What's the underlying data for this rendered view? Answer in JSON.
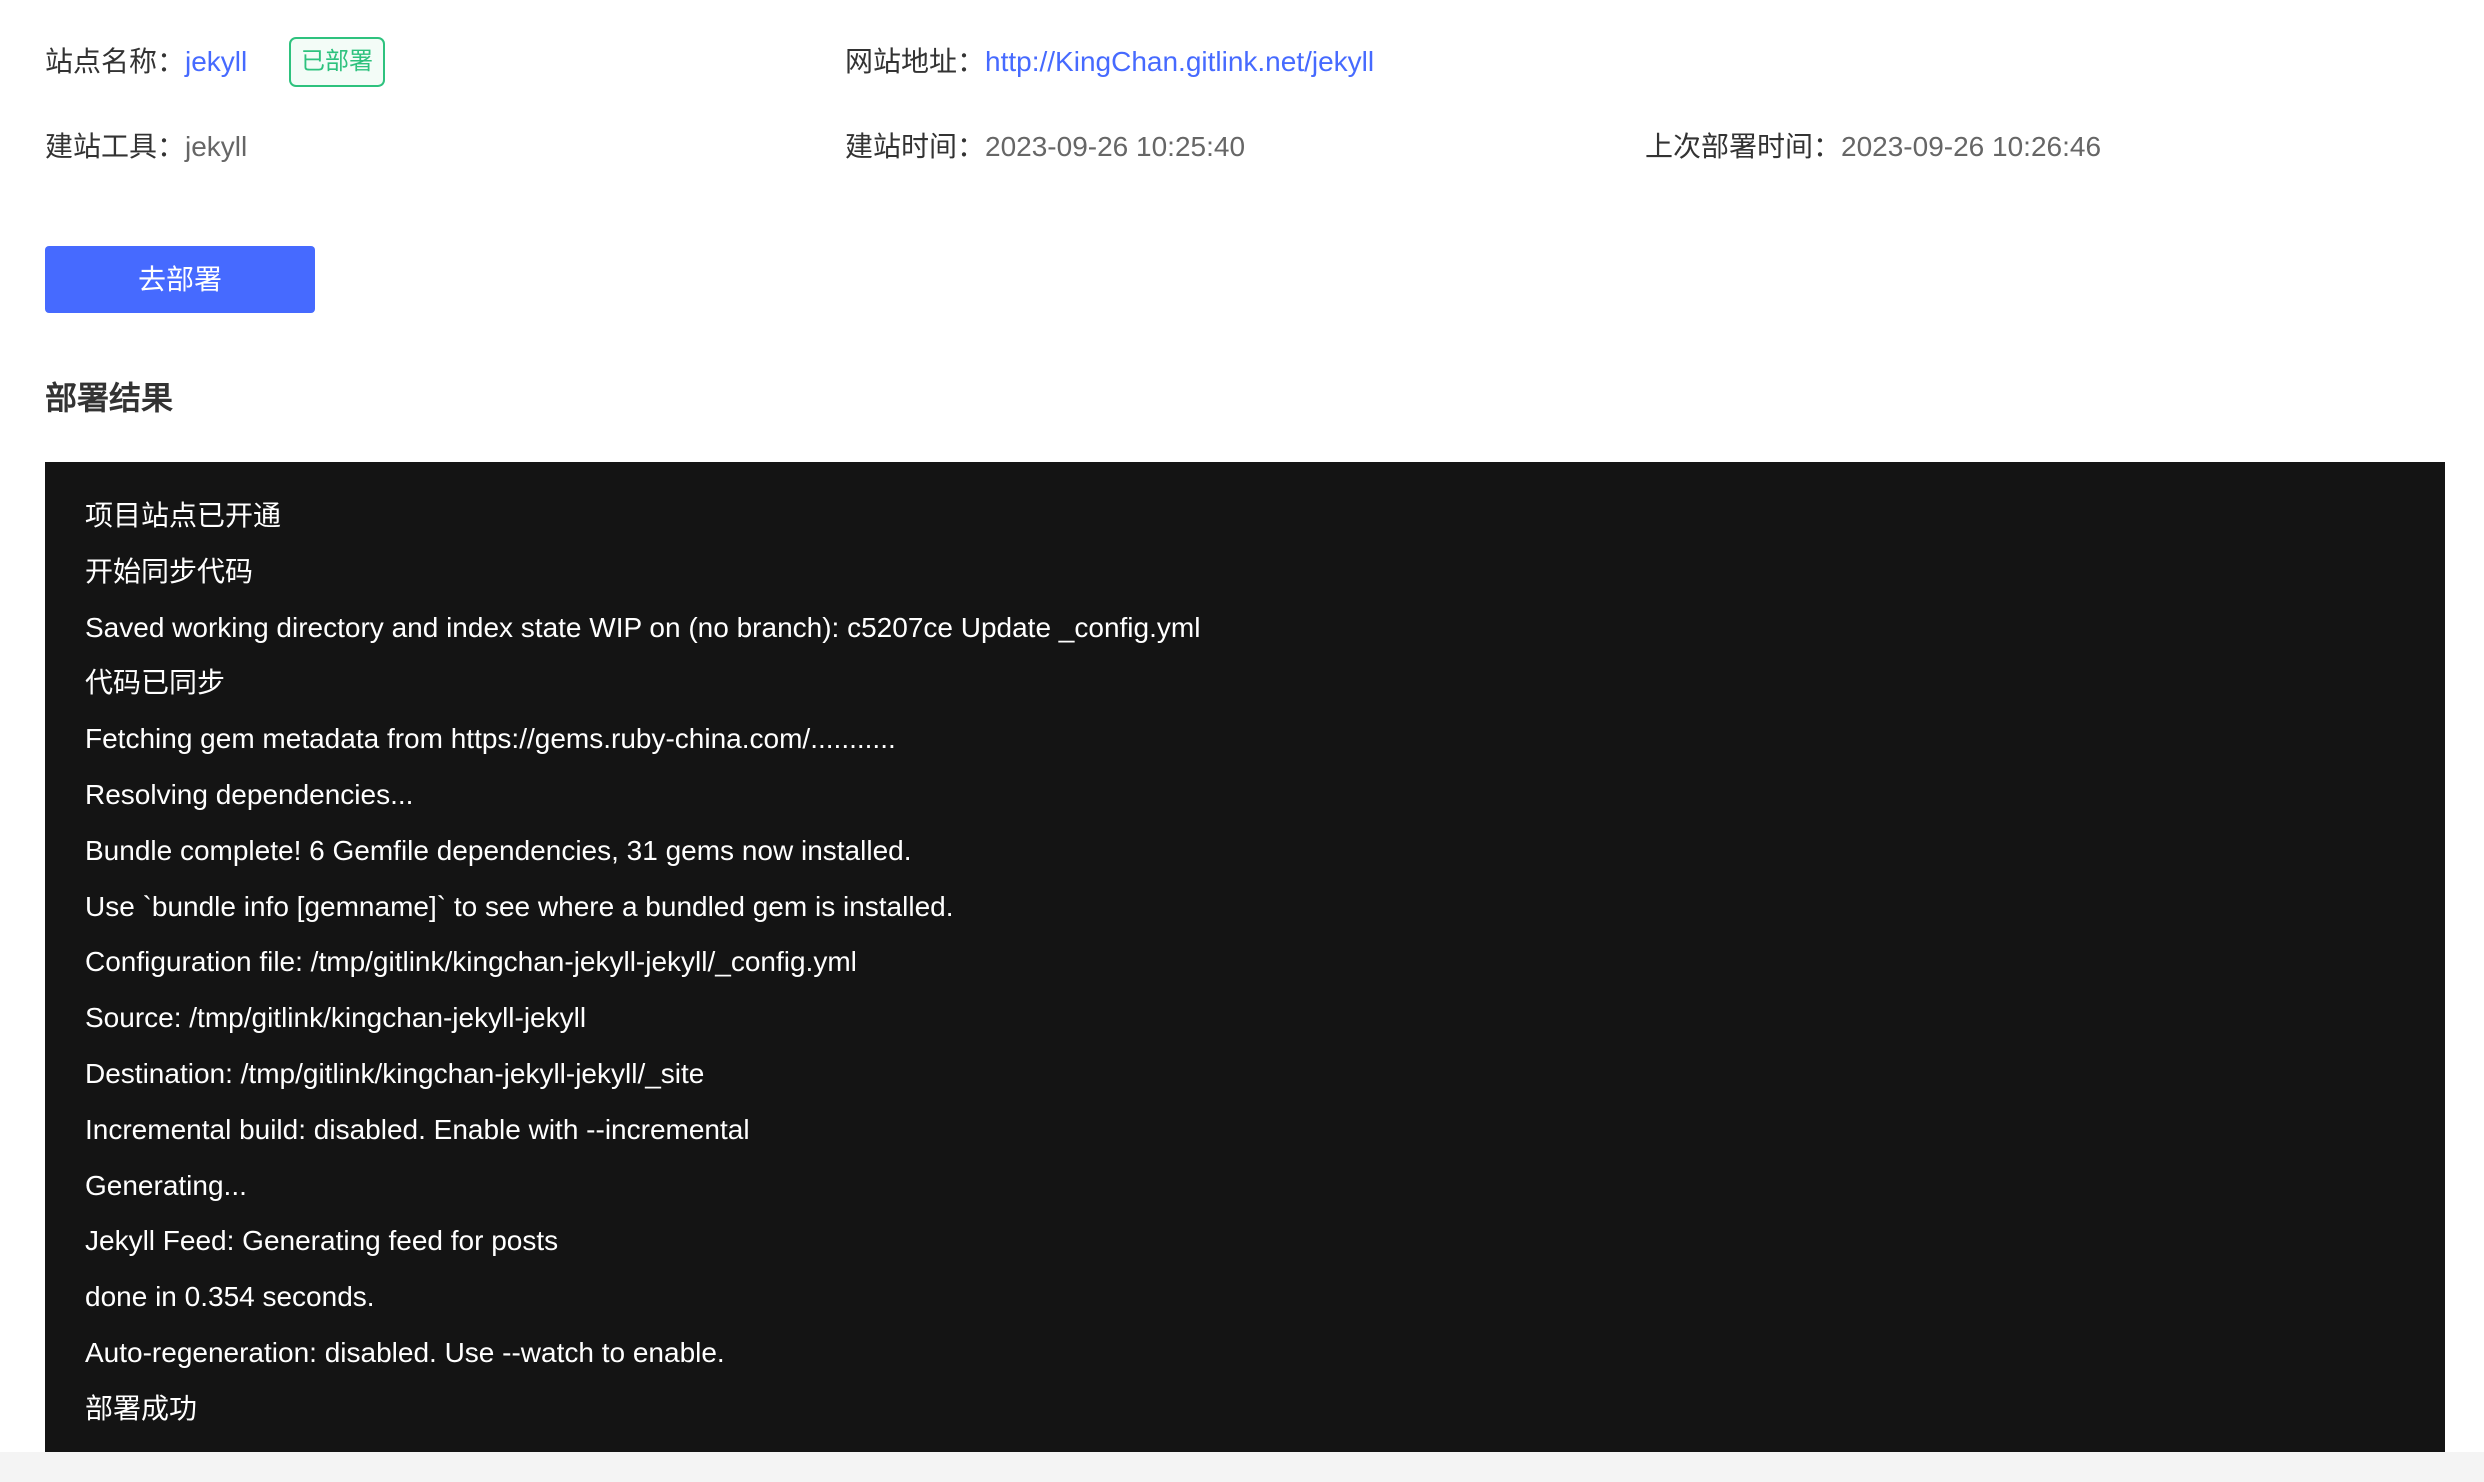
{
  "site_info": {
    "name_label": "站点名称：",
    "name_value": "jekyll",
    "status_badge": "已部署",
    "url_label": "网站地址：",
    "url_value": "http://KingChan.gitlink.net/jekyll",
    "tool_label": "建站工具：",
    "tool_value": "jekyll",
    "created_label": "建站时间：",
    "created_value": "2023-09-26 10:25:40",
    "last_deploy_label": "上次部署时间：",
    "last_deploy_value": "2023-09-26 10:26:46"
  },
  "deploy_button_label": "去部署",
  "result_section": {
    "title": "部署结果",
    "log_lines": [
      "项目站点已开通",
      "开始同步代码",
      "Saved working directory and index state WIP on (no branch): c5207ce Update _config.yml",
      "代码已同步",
      "Fetching gem metadata from https://gems.ruby-china.com/...........",
      "Resolving dependencies...",
      "Bundle complete! 6 Gemfile dependencies, 31 gems now installed.",
      "Use `bundle info [gemname]` to see where a bundled gem is installed.",
      "Configuration file: /tmp/gitlink/kingchan-jekyll-jekyll/_config.yml",
      "Source: /tmp/gitlink/kingchan-jekyll-jekyll",
      "Destination: /tmp/gitlink/kingchan-jekyll-jekyll/_site",
      "Incremental build: disabled. Enable with --incremental",
      "Generating...",
      "Jekyll Feed: Generating feed for posts",
      "done in 0.354 seconds.",
      "Auto-regeneration: disabled. Use --watch to enable.",
      "部署成功"
    ]
  },
  "colors": {
    "link": "#466aff",
    "button_bg": "#466aff",
    "badge": "#2ec27e",
    "log_bg": "#141414",
    "log_text": "#ffffff"
  }
}
